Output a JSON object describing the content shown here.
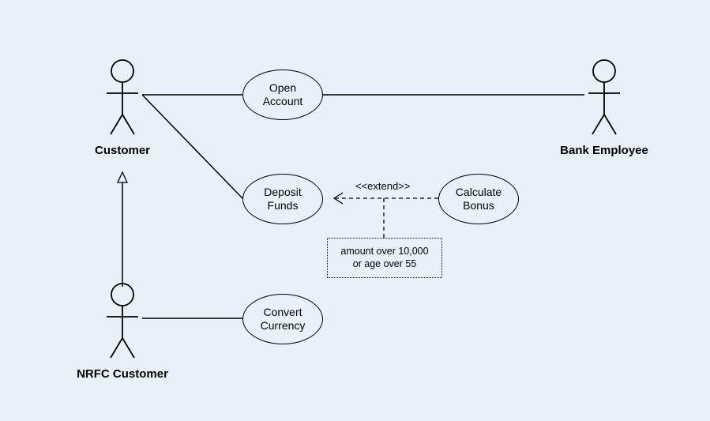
{
  "actors": {
    "customer": "Customer",
    "nrfc": "NRFC Customer",
    "employee": "Bank Employee"
  },
  "usecases": {
    "openAccount": {
      "line1": "Open",
      "line2": "Account"
    },
    "depositFunds": {
      "line1": "Deposit",
      "line2": "Funds"
    },
    "calculateBonus": {
      "line1": "Calculate",
      "line2": "Bonus"
    },
    "convertCurrency": {
      "line1": "Convert",
      "line2": "Currency"
    }
  },
  "extendLabel": "<<extend>>",
  "condition": {
    "line1": "amount over 10,000",
    "line2": "or age over 55"
  }
}
